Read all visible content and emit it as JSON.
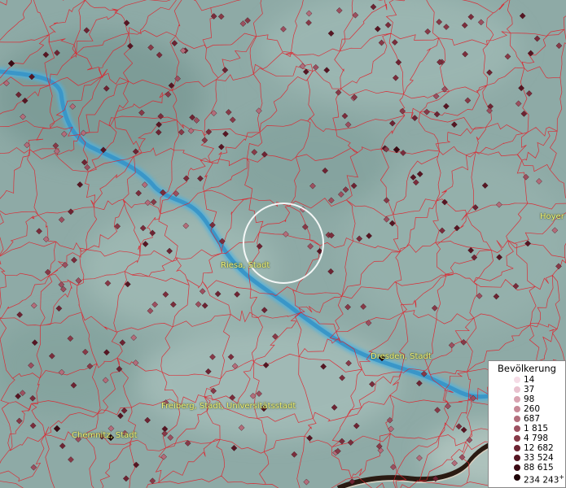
{
  "map": {
    "labels": {
      "riesa": "Riesa, Stadt",
      "dresden": "Dresden, Stadt",
      "freiberg": "Freiberg, Stadt, Universitätsstadt",
      "chemnitz": "Chemnitz, Stadt",
      "hoyerswerda": "Hoyer"
    },
    "colors": {
      "terrain": "#8eaaa6",
      "river": "#3f9fd0",
      "boundary": "#e0202a",
      "highlight": "#ffffff",
      "label": "#f2f27a"
    }
  },
  "legend": {
    "title": "Bevölkerung",
    "items": [
      {
        "label": "14",
        "color": "#f5dce6"
      },
      {
        "label": "37",
        "color": "#e9c2cf"
      },
      {
        "label": "98",
        "color": "#d9a3b1"
      },
      {
        "label": "260",
        "color": "#c78896"
      },
      {
        "label": "687",
        "color": "#b26d7b"
      },
      {
        "label": "1 815",
        "color": "#9c5060"
      },
      {
        "label": "4 798",
        "color": "#873a48"
      },
      {
        "label": "12 682",
        "color": "#6d2433"
      },
      {
        "label": "33 524",
        "color": "#561623"
      },
      {
        "label": "88 615",
        "color": "#3b0b14"
      },
      {
        "label": "234 243",
        "color": "#1f0508",
        "suffix": "+"
      }
    ]
  }
}
